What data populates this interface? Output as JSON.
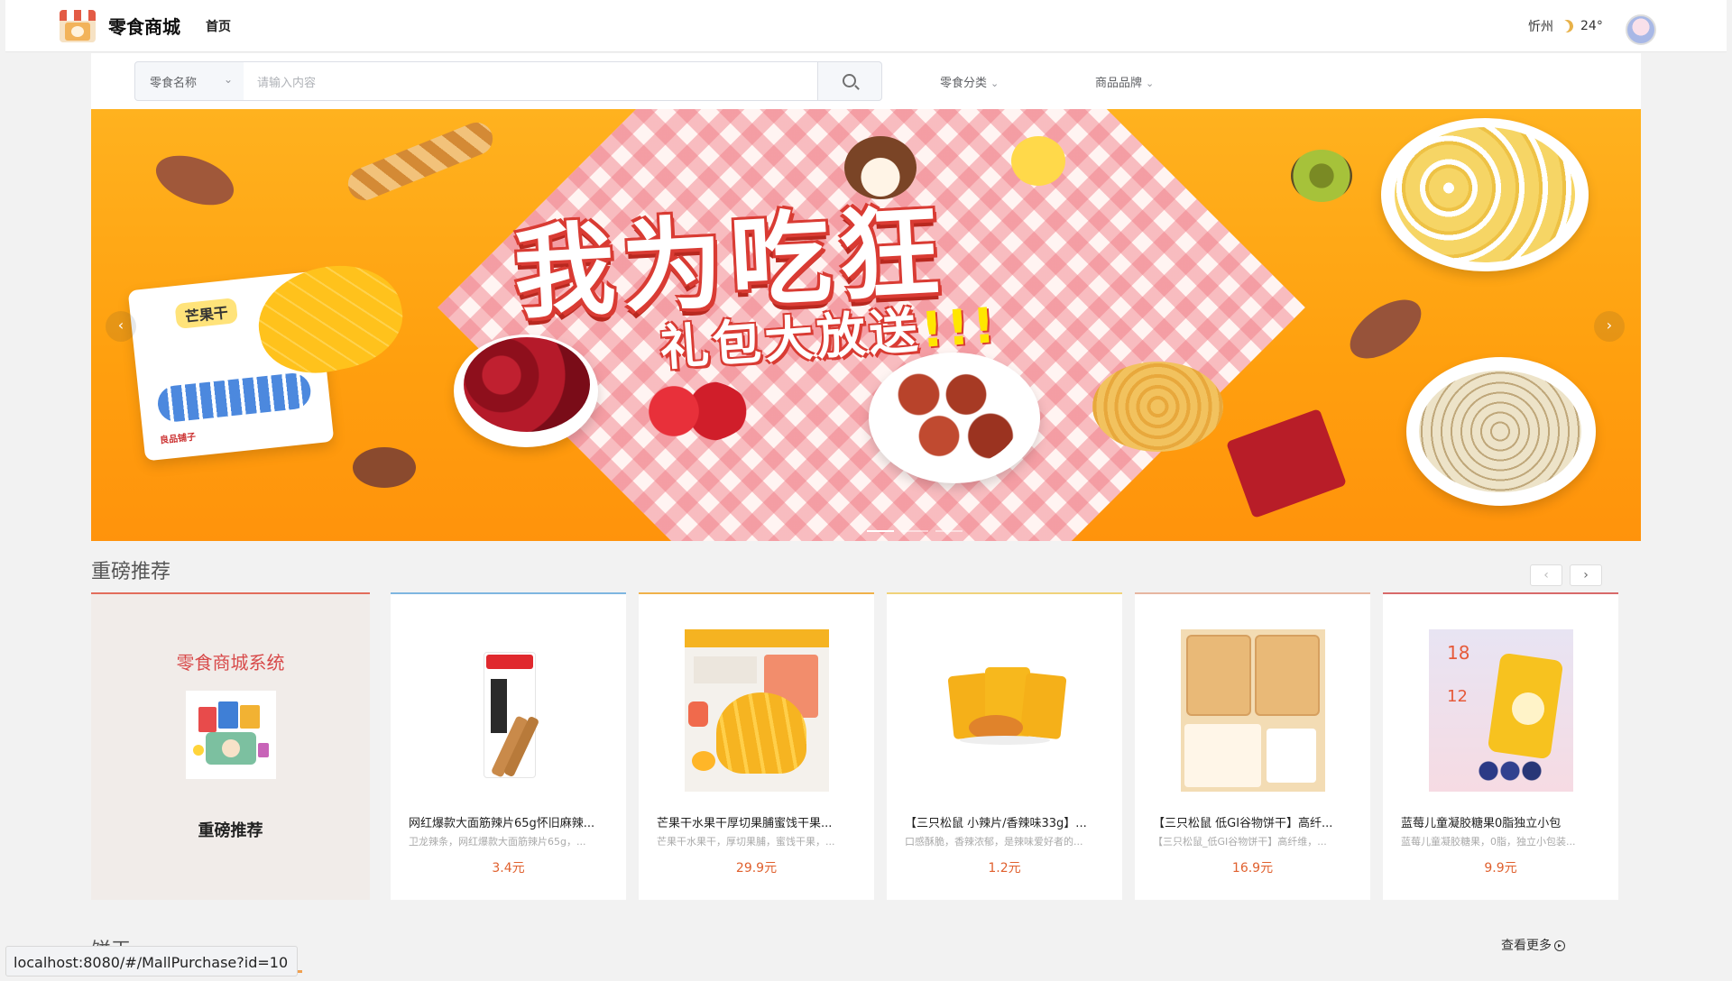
{
  "header": {
    "brand": "零食商城",
    "nav_home": "首页",
    "weather_city": "忻州",
    "weather_icon": "moon-icon",
    "weather_temp": "24°"
  },
  "search": {
    "category_select": "零食名称",
    "placeholder": "请输入内容",
    "dropdown_category": "零食分类",
    "dropdown_brand": "商品品牌"
  },
  "banner": {
    "title": "我为吃狂",
    "subtitle": "礼包大放送",
    "subtitle_mark": "!!!",
    "bag_title": "芒果干",
    "bag_brand": "良品铺子"
  },
  "recommend": {
    "section_title": "重磅推荐",
    "promo_title": "零食商城系统",
    "promo_label": "重磅推荐",
    "products": [
      {
        "name": "网红爆款大面筋辣片65g怀旧麻辣...",
        "desc": "卫龙辣条，网红爆款大面筋辣片65g，...",
        "price": "3.4元",
        "accent": "#7fb6e0"
      },
      {
        "name": "芒果干水果干厚切果脯蜜饯干果...",
        "desc": "芒果干水果干，厚切果脯，蜜饯干果，...",
        "price": "29.9元",
        "accent": "#f0b24a"
      },
      {
        "name": "【三只松鼠 小辣片/香辣味33g】...",
        "desc": "口感酥脆，香辣浓郁，是辣味爱好者的...",
        "price": "1.2元",
        "accent": "#f0d37a"
      },
      {
        "name": "【三只松鼠 低GI谷物饼干】高纤...",
        "desc": "【三只松鼠_低GI谷物饼干】高纤维，...",
        "price": "16.9元",
        "accent": "#e7b6a0"
      },
      {
        "name": "蓝莓儿童凝胶糖果0脂独立小包",
        "desc": "蓝莓儿童凝胶糖果，0脂，独立小包装...",
        "price": "9.9元",
        "accent": "#d86a6a"
      }
    ]
  },
  "footer": {
    "more_label": "查看更多",
    "next_section": "饼干",
    "status_url": "localhost:8080/#/MallPurchase?id=10"
  }
}
